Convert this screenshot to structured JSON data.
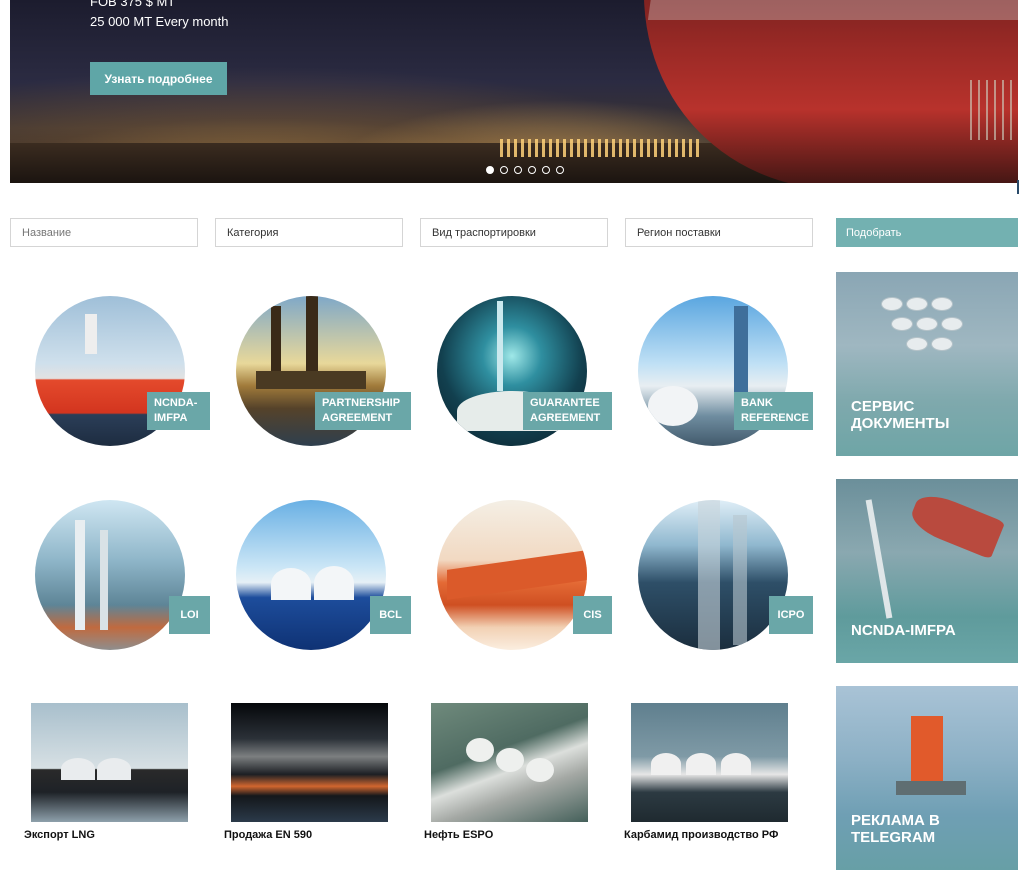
{
  "hero": {
    "line1": "FOB 375 $ MT",
    "line2": "25 000 MT Every month",
    "button_label": "Узнать подробнее",
    "slides_count": 6,
    "active_slide": 1
  },
  "filters": {
    "name_placeholder": "Название",
    "category": "Категория",
    "transport": "Вид траспортировки",
    "region": "Регион поставки",
    "submit_label": "Подобрать"
  },
  "categories": [
    {
      "label_line1": "NCNDA-",
      "label_line2": "IMFPA",
      "picture": "lng-tanker-arctic-princess"
    },
    {
      "label_line1": "PARTNERSHIP",
      "label_line2": "AGREEMENT",
      "picture": "oil-rig"
    },
    {
      "label_line1": "GUARANTEE",
      "label_line2": "AGREEMENT",
      "picture": "refinery-night"
    },
    {
      "label_line1": "BANK",
      "label_line2": "REFERENCE",
      "picture": "refinery-day"
    },
    {
      "label_line1": "LOI",
      "label_line2": "",
      "picture": "pipes-plant"
    },
    {
      "label_line1": "BCL",
      "label_line2": "",
      "picture": "lng-carrier-blue"
    },
    {
      "label_line1": "CIS",
      "label_line2": "",
      "picture": "tanker-cardinal"
    },
    {
      "label_line1": "ICPO",
      "label_line2": "",
      "picture": "refinery-column"
    }
  ],
  "products": [
    {
      "title": "Экспорт LNG"
    },
    {
      "title": "Продажа EN 590"
    },
    {
      "title": "Нефть ESPO"
    },
    {
      "title": "Карбамид производство РФ"
    }
  ],
  "sidebar": {
    "tile1_line1": "СЕРВИС",
    "tile1_line2": "ДОКУМЕНТЫ",
    "tile2_line1": "NCNDA-IMFPA",
    "tile3_line1": "РЕКЛАМА В",
    "tile3_line2": "TELEGRAM"
  },
  "colors": {
    "accent": "#6aa7a8",
    "button": "#5fa6a7"
  }
}
